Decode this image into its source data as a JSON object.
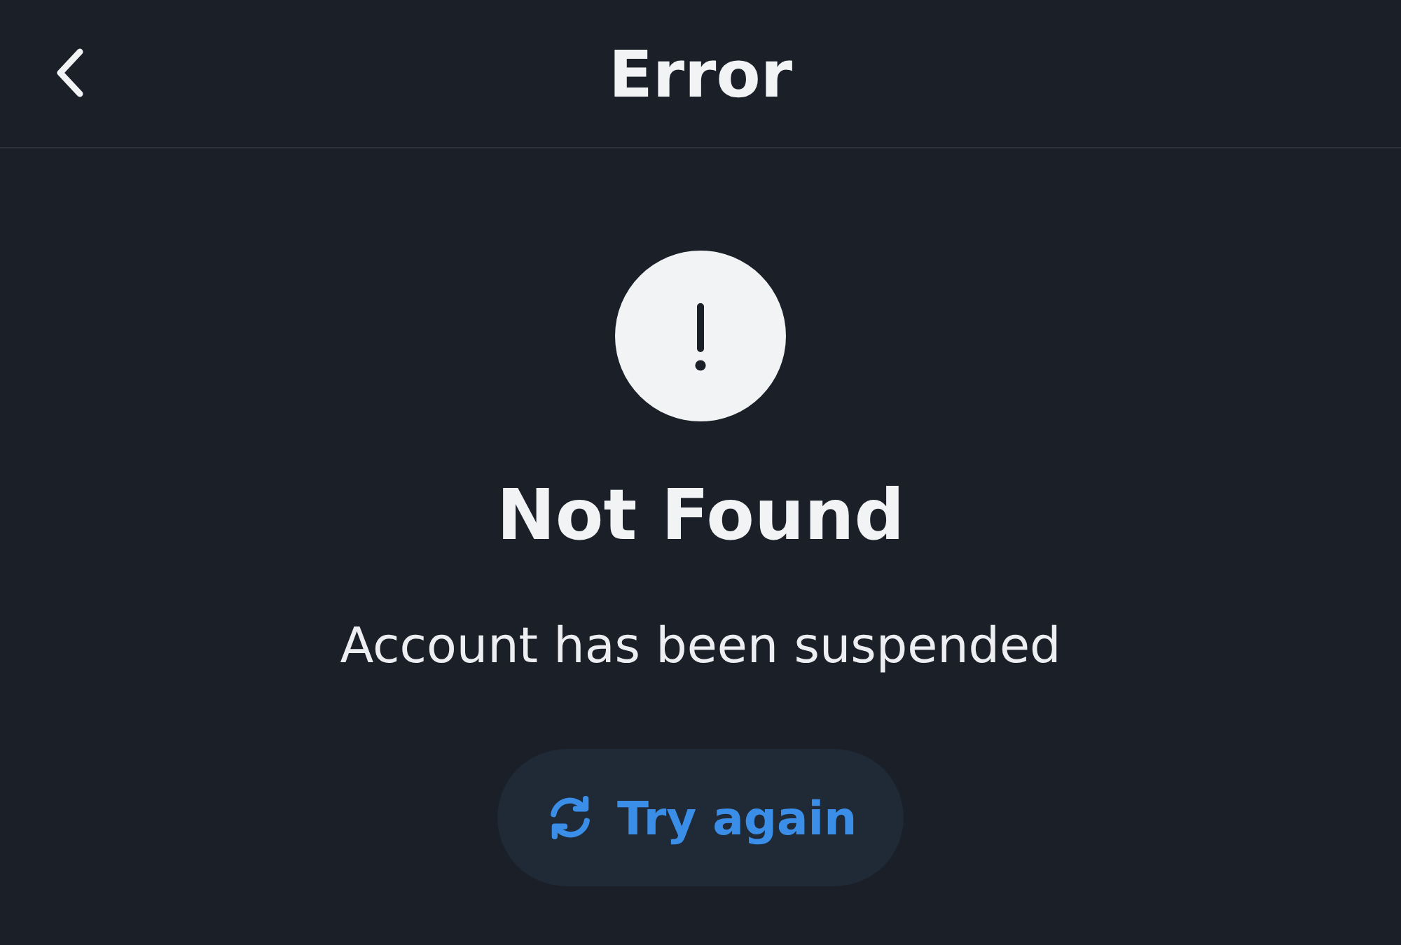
{
  "header": {
    "title": "Error"
  },
  "error": {
    "heading": "Not Found",
    "message": "Account has been suspended"
  },
  "retry_button": {
    "label": "Try again"
  }
}
